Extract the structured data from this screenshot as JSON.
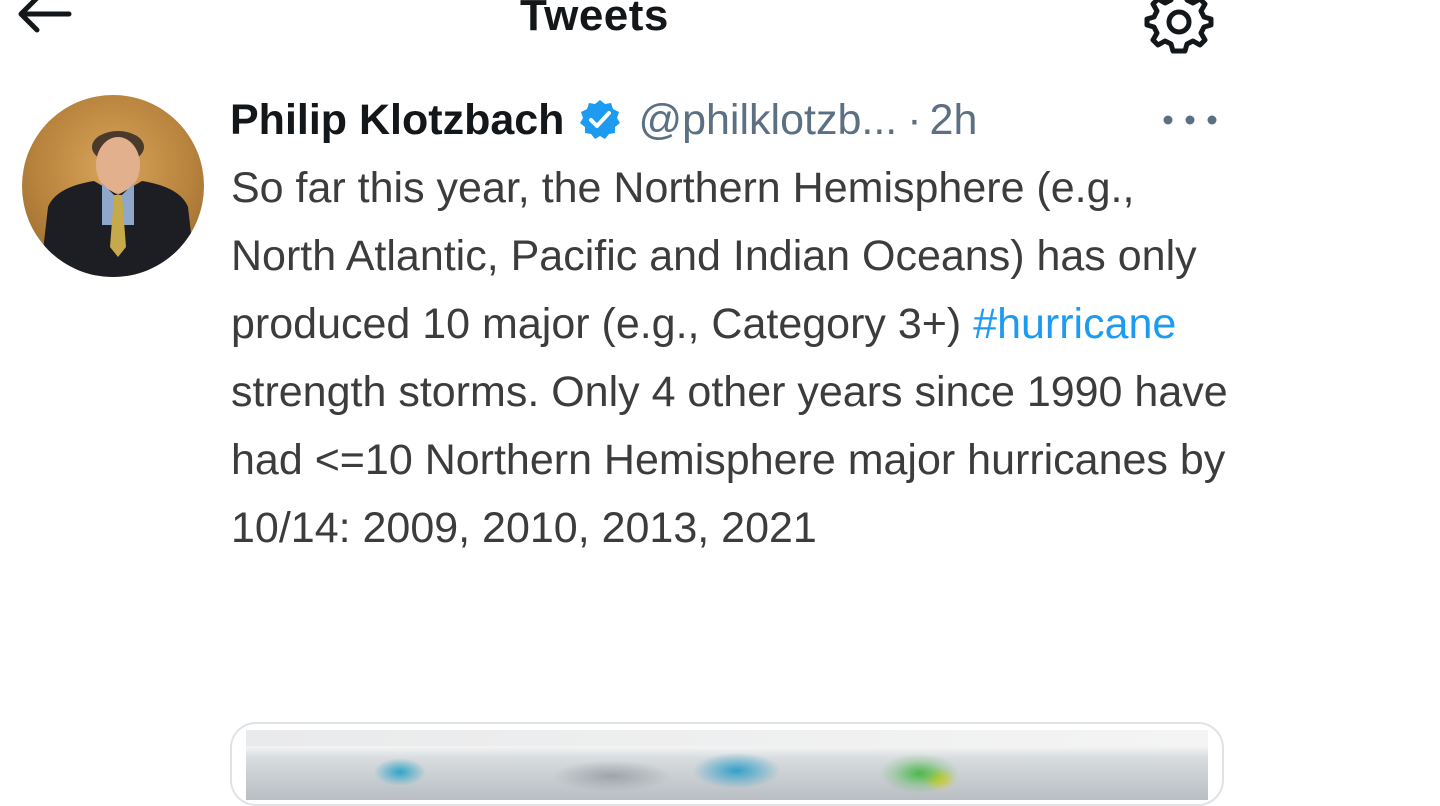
{
  "header": {
    "title": "Tweets",
    "back_icon": "arrow-left-icon",
    "settings_icon": "gear-icon"
  },
  "tweet": {
    "author_name": "Philip Klotzbach",
    "verified": true,
    "handle": "@philklotzb...",
    "separator": "·",
    "time": "2h",
    "more_label": "···",
    "text_before_hashtag": "So far this year, the Northern Hemisphere (e.g., North Atlantic, Pacific and Indian Oceans) has only produced 10 major (e.g., Category 3+) ",
    "hashtag": "#hurricane",
    "text_after_hashtag": " strength storms. Only 4 other years since 1990 have had <=10 Northern Hemisphere major hurricanes by 10/14: 2009, 2010, 2013, 2021"
  },
  "colors": {
    "accent": "#1d9bf0",
    "text_primary": "#14171a",
    "text_secondary": "#5b7083",
    "body_text": "#3c3c3c"
  }
}
